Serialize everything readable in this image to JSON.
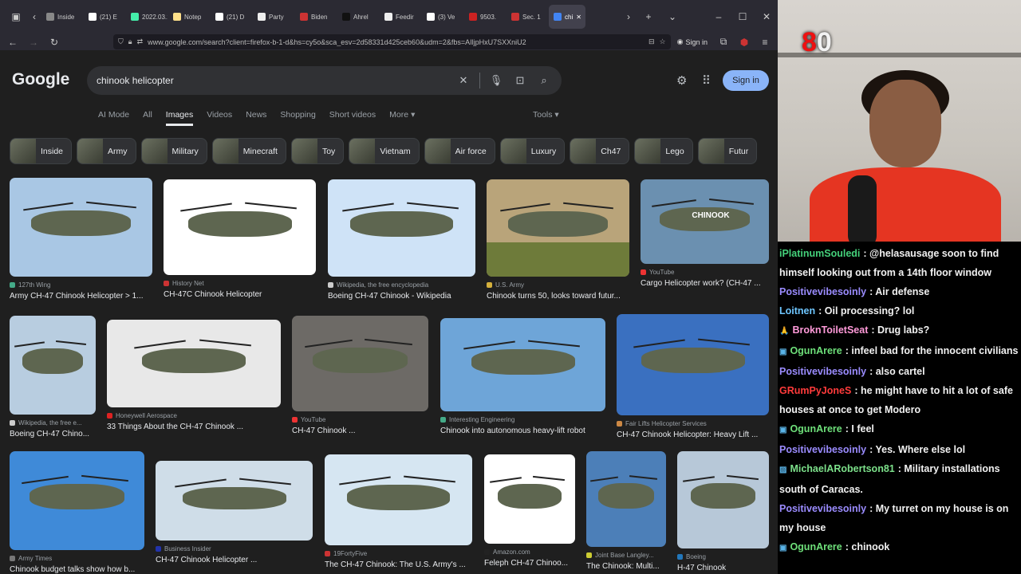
{
  "browser": {
    "tabs": [
      {
        "label": "Inside",
        "color": "#888"
      },
      {
        "label": "(21) E",
        "color": "#fff"
      },
      {
        "label": "2022.03.1",
        "color": "#4ea"
      },
      {
        "label": "Notep",
        "color": "#ffe08a"
      },
      {
        "label": "(21) D",
        "color": "#fff"
      },
      {
        "label": "Party",
        "color": "#eee"
      },
      {
        "label": "Biden",
        "color": "#c33"
      },
      {
        "label": "Ahrel",
        "color": "#111"
      },
      {
        "label": "Feedir",
        "color": "#eee"
      },
      {
        "label": "(3) Ve",
        "color": "#fff"
      },
      {
        "label": "9503.",
        "color": "#c22"
      },
      {
        "label": "Sec. 1",
        "color": "#c33"
      },
      {
        "label": "chi",
        "color": "#4285f4"
      }
    ],
    "url": "www.google.com/search?client=firefox-b-1-d&hs=cy5o&sca_esv=2d58331d425ceb60&udm=2&fbs=AIljpHxU7SXXniU2",
    "signin": "Sign in"
  },
  "google": {
    "logo": "Google",
    "query": "chinook helicopter",
    "signin": "Sign in",
    "tabs": [
      "AI Mode",
      "All",
      "Images",
      "Videos",
      "News",
      "Shopping",
      "Short videos",
      "More"
    ],
    "tools": "Tools",
    "chips": [
      "Inside",
      "Army",
      "Military",
      "Minecraft",
      "Toy",
      "Vietnam",
      "Air force",
      "Luxury",
      "Ch47",
      "Lego",
      "Futur"
    ]
  },
  "results": [
    {
      "source": "127th Wing",
      "title": "Army CH-47 Chinook Helicopter > 1...",
      "fav": "#4a8"
    },
    {
      "source": "History Net",
      "title": "CH-47C Chinook Helicopter",
      "fav": "#c33"
    },
    {
      "source": "Wikipedia, the free encyclopedia",
      "title": "Boeing CH-47 Chinook - Wikipedia",
      "fav": "#ccc"
    },
    {
      "source": "U.S. Army",
      "title": "Chinook turns 50, looks toward futur...",
      "fav": "#d4b03c"
    },
    {
      "source": "YouTube",
      "title": "Cargo Helicopter work? (CH-47 ...",
      "fav": "#e33"
    },
    {
      "source": "Wikipedia, the free e...",
      "title": "Boeing CH-47 Chino...",
      "fav": "#ccc"
    },
    {
      "source": "Honeywell Aerospace",
      "title": "33 Things About the CH-47 Chinook ...",
      "fav": "#d22"
    },
    {
      "source": "YouTube",
      "title": "CH-47 Chinook ...",
      "fav": "#e33"
    },
    {
      "source": "Interesting Engineering",
      "title": "Chinook into autonomous heavy-lift robot",
      "fav": "#4a8"
    },
    {
      "source": "Fair Lifts Helicopter Services",
      "title": "CH-47 Chinook Helicopter: Heavy Lift ...",
      "fav": "#c84"
    },
    {
      "source": "Army Times",
      "title": "Chinook budget talks show how b...",
      "fav": "#777"
    },
    {
      "source": "Business Insider",
      "title": "CH-47 Chinook Helicopter ...",
      "fav": "#23a"
    },
    {
      "source": "19FortyFive",
      "title": "The CH-47 Chinook: The U.S. Army's ...",
      "fav": "#c33"
    },
    {
      "source": "Amazon.com",
      "title": "Feleph CH-47 Chinoo...",
      "fav": "#222"
    },
    {
      "source": "Joint Base Langley...",
      "title": "The Chinook: Multi...",
      "fav": "#cc3"
    },
    {
      "source": "Boeing",
      "title": "H-47 Chinook",
      "fav": "#27b"
    }
  ],
  "image_overlay_text": "CHINOOK",
  "stream": {
    "counter_red": "8",
    "counter_white": "0",
    "chat": [
      {
        "user": "iPlatinumSouledi",
        "color": "#44d07a",
        "text": "@helasausage soon to find himself looking out from a 14th floor window",
        "badge": ""
      },
      {
        "user": "Positivevibesoinly",
        "color": "#9b8cff",
        "text": "Air defense",
        "badge": ""
      },
      {
        "user": "Loitnen",
        "color": "#6ec6ff",
        "text": "Oil processing? lol",
        "badge": ""
      },
      {
        "user": "BroknToiletSeat",
        "color": "#ff9ad9",
        "text": "Drug labs?",
        "badge": "🙏"
      },
      {
        "user": "OgunArere",
        "color": "#6ee07a",
        "text": "infeel bad for the innocent civilians",
        "badge": "▣"
      },
      {
        "user": "Positivevibesoinly",
        "color": "#9b8cff",
        "text": "also cartel",
        "badge": ""
      },
      {
        "user": "GRumPyJoneS",
        "color": "#ff3b3b",
        "text": "he might have to hit a lot of safe houses at once to get Modero",
        "badge": ""
      },
      {
        "user": "OgunArere",
        "color": "#6ee07a",
        "text": "I feel",
        "badge": "▣"
      },
      {
        "user": "Positivevibesoinly",
        "color": "#9b8cff",
        "text": "Yes. Where else lol",
        "badge": ""
      },
      {
        "user": "MichaelARobertson81",
        "color": "#7ce08a",
        "text": "Military installations south of Caracas.",
        "badge": "▨"
      },
      {
        "user": "Positivevibesoinly",
        "color": "#9b8cff",
        "text": "My turret on my house is on my house",
        "badge": ""
      },
      {
        "user": "OgunArere",
        "color": "#6ee07a",
        "text": "chinook",
        "badge": "▣"
      }
    ]
  }
}
